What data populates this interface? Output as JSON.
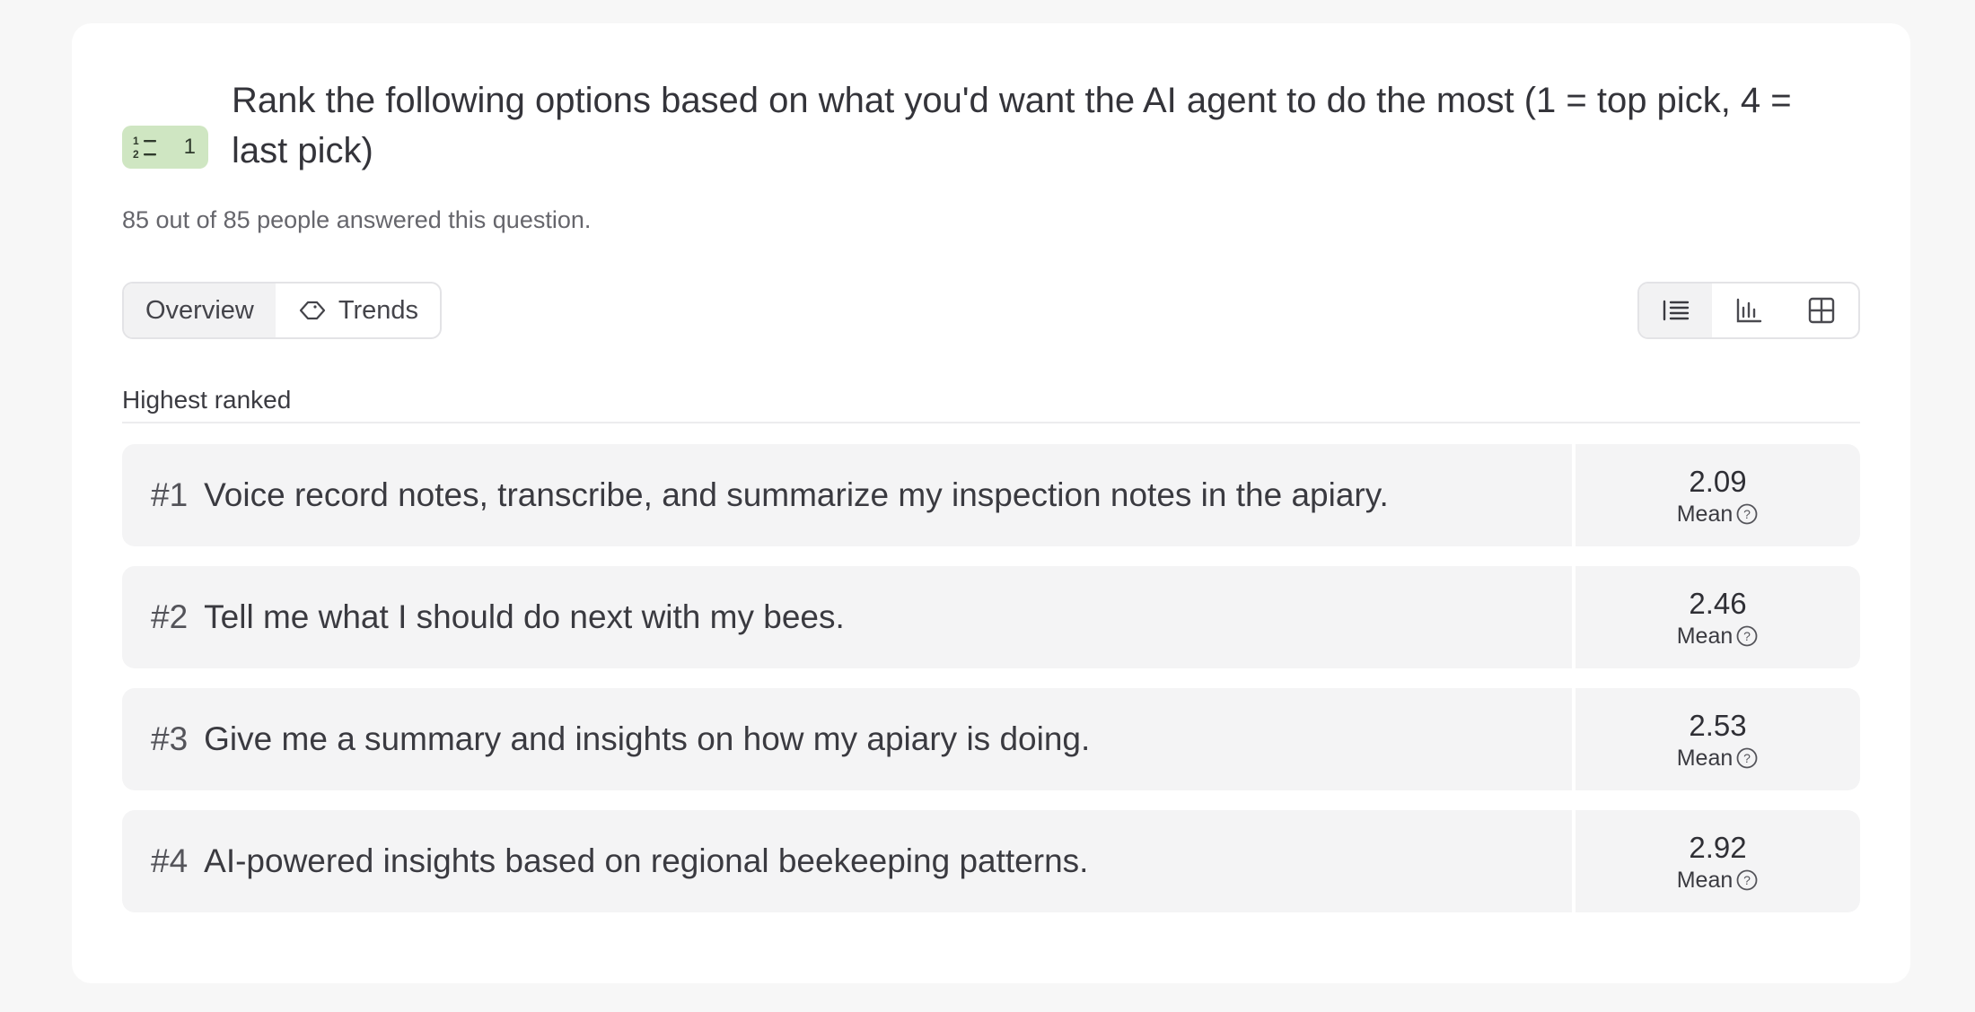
{
  "question": {
    "badge_number": "1",
    "title": "Rank the following options based on what you'd want the AI agent to do the most (1 = top pick, 4 = last pick)",
    "answered_text": "85 out of 85 people answered this question."
  },
  "tabs": [
    {
      "label": "Overview",
      "active": true
    },
    {
      "label": "Trends",
      "icon": "tag-icon",
      "active": false
    }
  ],
  "view_toggle": [
    "list-view-icon",
    "bar-chart-icon",
    "grid-view-icon"
  ],
  "section_label": "Highest ranked",
  "stat_label": "Mean",
  "rankings": [
    {
      "rank": "#1",
      "text": "Voice record notes, transcribe, and summarize my inspection notes in the apiary.",
      "mean": "2.09"
    },
    {
      "rank": "#2",
      "text": "Tell me what I should do next with my bees.",
      "mean": "2.46"
    },
    {
      "rank": "#3",
      "text": "Give me a summary and insights on how my apiary is doing.",
      "mean": "2.53"
    },
    {
      "rank": "#4",
      "text": "AI-powered insights based on regional beekeeping patterns.",
      "mean": "2.92"
    }
  ]
}
